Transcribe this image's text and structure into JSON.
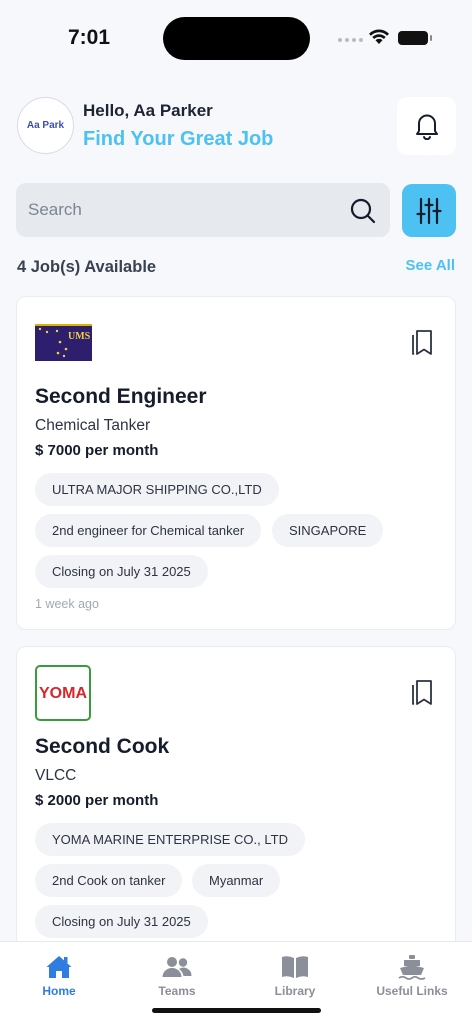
{
  "status_bar": {
    "time": "7:01"
  },
  "header": {
    "avatar_text": "Aa Park",
    "greeting": "Hello, Aa Parker",
    "tagline": "Find Your Great Job"
  },
  "search": {
    "placeholder": "Search"
  },
  "jobs": {
    "count_label": "4 Job(s) Available",
    "see_all": "See All",
    "items": [
      {
        "logo_text": "UMS",
        "title": "Second Engineer",
        "ship_type": "Chemical Tanker",
        "salary": "$ 7000 per month",
        "company": "ULTRA MAJOR SHIPPING CO.,LTD",
        "description": "2nd engineer for Chemical tanker",
        "location": "SINGAPORE",
        "closing": "Closing on July 31 2025",
        "posted": "1 week ago"
      },
      {
        "logo_text": "YOMA",
        "title": "Second Cook",
        "ship_type": "VLCC",
        "salary": "$ 2000 per month",
        "company": "YOMA MARINE ENTERPRISE CO., LTD",
        "description": "2nd Cook on tanker",
        "location": "Myanmar",
        "closing": "Closing on July 31 2025"
      }
    ]
  },
  "tabs": [
    {
      "label": "Home",
      "icon": "home-icon",
      "active": true
    },
    {
      "label": "Teams",
      "icon": "teams-icon",
      "active": false
    },
    {
      "label": "Library",
      "icon": "library-icon",
      "active": false
    },
    {
      "label": "Useful Links",
      "icon": "ship-icon",
      "active": false
    }
  ],
  "colors": {
    "accent": "#4cc1f2",
    "active_tab": "#2f7de1",
    "background": "#f6f8fb"
  }
}
